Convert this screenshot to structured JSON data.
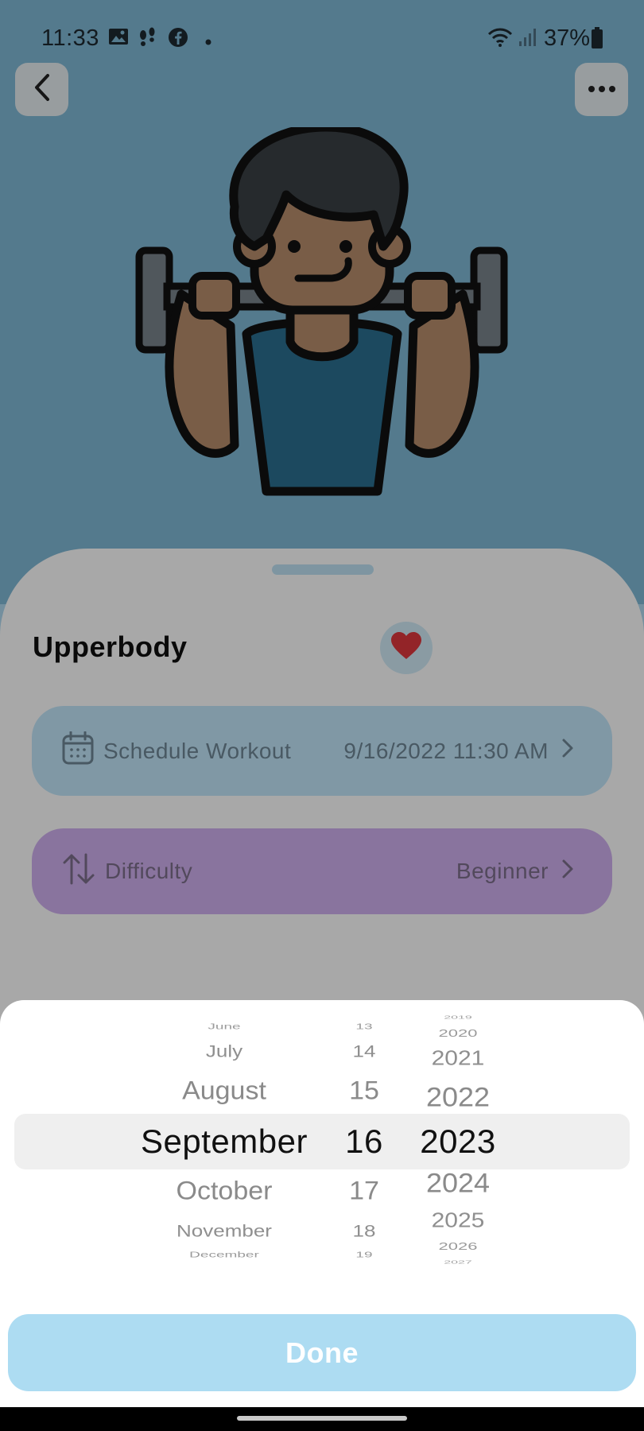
{
  "status_bar": {
    "time": "11:33",
    "battery": "37%",
    "icons": [
      "gallery-icon",
      "steps-icon",
      "facebook-icon",
      "dot-icon",
      "wifi-icon",
      "signal-icon",
      "battery-icon"
    ]
  },
  "header": {
    "back_icon": "chevron-left-icon",
    "more_icon": "more-horizontal-icon",
    "illustration": "weightlifter-illustration"
  },
  "workout": {
    "title": "Upperbody",
    "favorite_icon": "heart-icon",
    "schedule": {
      "icon": "calendar-icon",
      "label": "Schedule Workout",
      "value": "9/16/2022 11:30 AM"
    },
    "difficulty": {
      "icon": "sort-arrows-icon",
      "label": "Difficulty",
      "value": "Beginner"
    }
  },
  "date_picker": {
    "months": [
      "June",
      "July",
      "August",
      "September",
      "October",
      "November",
      "December"
    ],
    "days": [
      "13",
      "14",
      "15",
      "16",
      "17",
      "18",
      "19"
    ],
    "years": [
      "2019",
      "2020",
      "2021",
      "2022",
      "2023",
      "2024",
      "2025",
      "2026",
      "2027"
    ],
    "selected_month": "September",
    "selected_day": "16",
    "selected_year": "2023",
    "done_label": "Done"
  },
  "colors": {
    "hero_bg": "#80b9d6",
    "schedule_card": "#c3e7fb",
    "difficulty_card": "#d1b1f0",
    "done_button": "#addcf2",
    "heart": "#e0383e"
  }
}
